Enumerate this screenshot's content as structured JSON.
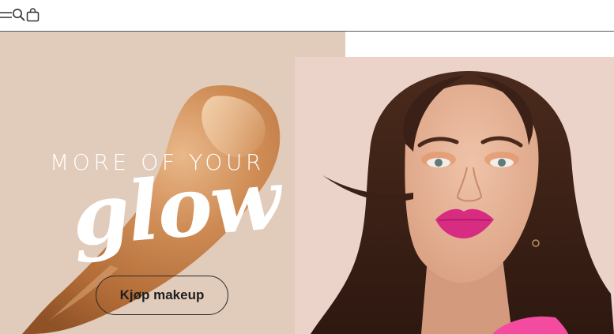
{
  "header": {
    "icons": [
      "menu-icon",
      "search-icon",
      "shopping-bag-icon"
    ]
  },
  "hero": {
    "tagline": "MORE OF YOUR",
    "headline": "glow",
    "cta_label": "Kjøp makeup",
    "colors": {
      "left_panel": "#e1cbbb",
      "right_panel": "#ecd3ca",
      "text": "#ffffff",
      "button_border": "#2a2a2a"
    }
  }
}
